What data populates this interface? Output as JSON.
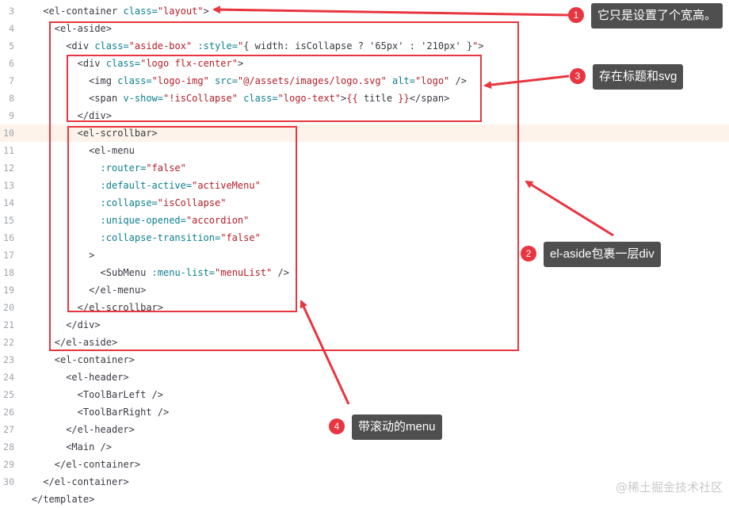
{
  "editor": {
    "lines": [
      {
        "n": "3",
        "indent": 6,
        "tokens": [
          [
            "tag",
            "<el-container "
          ],
          [
            "attr",
            "class="
          ],
          [
            "str",
            "\"layout\""
          ],
          [
            "tag",
            ">"
          ]
        ]
      },
      {
        "n": "4",
        "indent": 8,
        "tokens": [
          [
            "tag",
            "<el-aside>"
          ]
        ]
      },
      {
        "n": "5",
        "indent": 10,
        "tokens": [
          [
            "tag",
            "<div "
          ],
          [
            "attr",
            "class="
          ],
          [
            "str",
            "\"aside-box\""
          ],
          [
            "tag",
            " "
          ],
          [
            "attr",
            ":style="
          ],
          [
            "str",
            "\""
          ],
          [
            "txt",
            "{ width: isCollapse ? '65px' : '210px' }"
          ],
          [
            "str",
            "\""
          ],
          [
            "tag",
            ">"
          ]
        ]
      },
      {
        "n": "6",
        "indent": 12,
        "tokens": [
          [
            "tag",
            "<div "
          ],
          [
            "attr",
            "class="
          ],
          [
            "str",
            "\"logo flx-center\""
          ],
          [
            "tag",
            ">"
          ]
        ]
      },
      {
        "n": "7",
        "indent": 14,
        "tokens": [
          [
            "tag",
            "<img "
          ],
          [
            "attr",
            "class="
          ],
          [
            "str",
            "\"logo-img\""
          ],
          [
            "tag",
            " "
          ],
          [
            "attr",
            "src="
          ],
          [
            "str",
            "\"@/assets/images/logo.svg\""
          ],
          [
            "tag",
            " "
          ],
          [
            "attr",
            "alt="
          ],
          [
            "str",
            "\"logo\""
          ],
          [
            "tag",
            " />"
          ]
        ]
      },
      {
        "n": "8",
        "indent": 14,
        "tokens": [
          [
            "tag",
            "<span "
          ],
          [
            "attr",
            "v-show="
          ],
          [
            "str",
            "\"!isCollapse\""
          ],
          [
            "tag",
            " "
          ],
          [
            "attr",
            "class="
          ],
          [
            "str",
            "\"logo-text\""
          ],
          [
            "tag",
            ">"
          ],
          [
            "str",
            "{{ "
          ],
          [
            "txt",
            "title"
          ],
          [
            "str",
            " }}"
          ],
          [
            "tag",
            "</span>"
          ]
        ]
      },
      {
        "n": "9",
        "indent": 12,
        "tokens": [
          [
            "tag",
            "</div>"
          ]
        ]
      },
      {
        "n": "10",
        "indent": 12,
        "highlight": true,
        "tokens": [
          [
            "tag",
            "<el-scrollbar>"
          ]
        ]
      },
      {
        "n": "11",
        "indent": 14,
        "tokens": [
          [
            "tag",
            "<el-menu"
          ]
        ]
      },
      {
        "n": "12",
        "indent": 16,
        "tokens": [
          [
            "attr",
            ":router="
          ],
          [
            "str",
            "\"false\""
          ]
        ]
      },
      {
        "n": "13",
        "indent": 16,
        "tokens": [
          [
            "attr",
            ":default-active="
          ],
          [
            "str",
            "\"activeMenu\""
          ]
        ]
      },
      {
        "n": "14",
        "indent": 16,
        "tokens": [
          [
            "attr",
            ":collapse="
          ],
          [
            "str",
            "\"isCollapse\""
          ]
        ]
      },
      {
        "n": "15",
        "indent": 16,
        "tokens": [
          [
            "attr",
            ":unique-opened="
          ],
          [
            "str",
            "\"accordion\""
          ]
        ]
      },
      {
        "n": "16",
        "indent": 16,
        "tokens": [
          [
            "attr",
            ":collapse-transition="
          ],
          [
            "str",
            "\"false\""
          ]
        ]
      },
      {
        "n": "17",
        "indent": 14,
        "tokens": [
          [
            "tag",
            ">"
          ]
        ]
      },
      {
        "n": "18",
        "indent": 16,
        "tokens": [
          [
            "tag",
            "<SubMenu "
          ],
          [
            "attr",
            ":menu-list="
          ],
          [
            "str",
            "\"menuList\""
          ],
          [
            "tag",
            " />"
          ]
        ]
      },
      {
        "n": "19",
        "indent": 14,
        "tokens": [
          [
            "tag",
            "</el-menu>"
          ]
        ]
      },
      {
        "n": "20",
        "indent": 12,
        "tokens": [
          [
            "tag",
            "</el-scrollbar>"
          ]
        ]
      },
      {
        "n": "21",
        "indent": 10,
        "tokens": [
          [
            "tag",
            "</div>"
          ]
        ]
      },
      {
        "n": "22",
        "indent": 8,
        "tokens": [
          [
            "tag",
            "</el-aside>"
          ]
        ]
      },
      {
        "n": "23",
        "indent": 8,
        "tokens": [
          [
            "tag",
            "<el-container>"
          ]
        ]
      },
      {
        "n": "24",
        "indent": 10,
        "tokens": [
          [
            "tag",
            "<el-header>"
          ]
        ]
      },
      {
        "n": "25",
        "indent": 12,
        "tokens": [
          [
            "tag",
            "<ToolBarLeft />"
          ]
        ]
      },
      {
        "n": "26",
        "indent": 12,
        "tokens": [
          [
            "tag",
            "<ToolBarRight />"
          ]
        ]
      },
      {
        "n": "27",
        "indent": 10,
        "tokens": [
          [
            "tag",
            "</el-header>"
          ]
        ]
      },
      {
        "n": "28",
        "indent": 10,
        "tokens": [
          [
            "tag",
            "<Main />"
          ]
        ]
      },
      {
        "n": "29",
        "indent": 8,
        "tokens": [
          [
            "tag",
            "</el-container>"
          ]
        ]
      },
      {
        "n": "30",
        "indent": 6,
        "tokens": [
          [
            "tag",
            "</el-container>"
          ]
        ]
      },
      {
        "n": "",
        "indent": 4,
        "tokens": [
          [
            "tag",
            "</template>"
          ]
        ]
      }
    ]
  },
  "annotations": [
    {
      "badge": "1",
      "text": "它只是设置了个宽高。"
    },
    {
      "badge": "3",
      "text": "存在标题和svg"
    },
    {
      "badge": "2",
      "text": "el-aside包裹一层div"
    },
    {
      "badge": "4",
      "text": "带滚动的menu"
    }
  ],
  "watermark": "@稀土掘金技术社区",
  "colors": {
    "annotation_red": "#e8353f",
    "callout_bg": "#4f4f4f",
    "highlight_line": "#fdf3ea"
  }
}
